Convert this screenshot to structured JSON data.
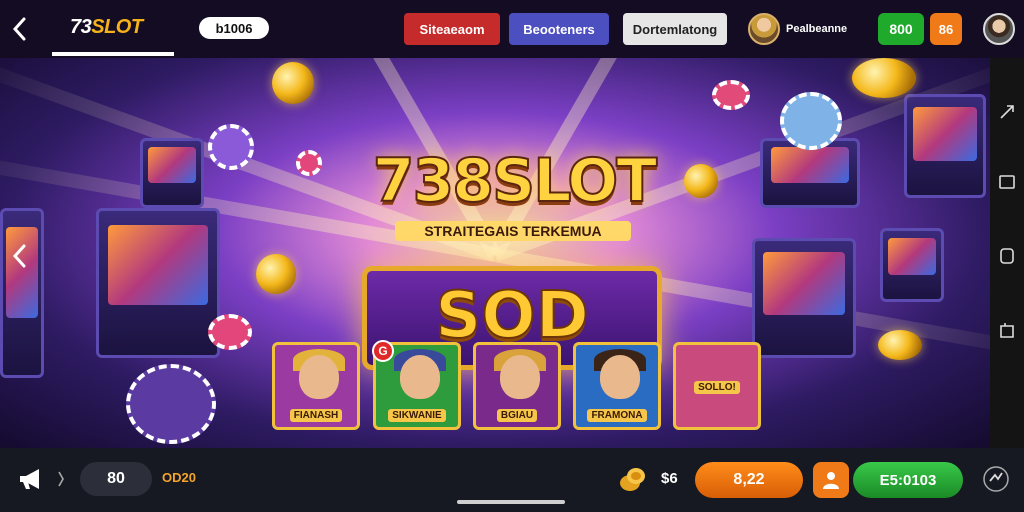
{
  "header": {
    "logo_text": "73SLOT",
    "balance": "b1006",
    "nav": [
      {
        "label": "Siteaeaom",
        "color": "#c62b2b"
      },
      {
        "label": "Beooteners",
        "color": "#4c4fbf"
      },
      {
        "label": "Dortemlatong",
        "color": "#e6e6e6"
      }
    ],
    "profile_name": "Pealbeanne",
    "coin_button": "800",
    "badge_button": "86"
  },
  "hero": {
    "title": "738SLOT",
    "subtitle": "STRAITEGAIS TERKEMUA",
    "banner_text": "SOD",
    "games": [
      {
        "label": "FIANASH",
        "bg": "#9b3aa0"
      },
      {
        "label": "SIKWANIE",
        "bg": "#2e9c3c"
      },
      {
        "label": "BGIAU",
        "bg": "#7a2a8a"
      },
      {
        "label": "FRAMONA",
        "bg": "#2a6cc2"
      },
      {
        "label": "SOLLO!",
        "bg": "#c94a7c"
      }
    ],
    "new_badge": "G"
  },
  "bottom": {
    "dark_pill": "80",
    "orange_text": "OD20",
    "value_label": "$6",
    "bet_value": "8,22",
    "spin_label": "E5:0103"
  },
  "icons": {
    "back": "chevron-left-icon",
    "hero_prev": "chevron-left-icon",
    "rail": [
      "share-icon",
      "square-icon",
      "rounded-square-icon",
      "tab-icon"
    ],
    "bottom_left": [
      "megaphone-icon",
      "chevron-right-icon"
    ],
    "bottom_right": [
      "coins-icon",
      "person-icon",
      "refresh-icon"
    ]
  }
}
